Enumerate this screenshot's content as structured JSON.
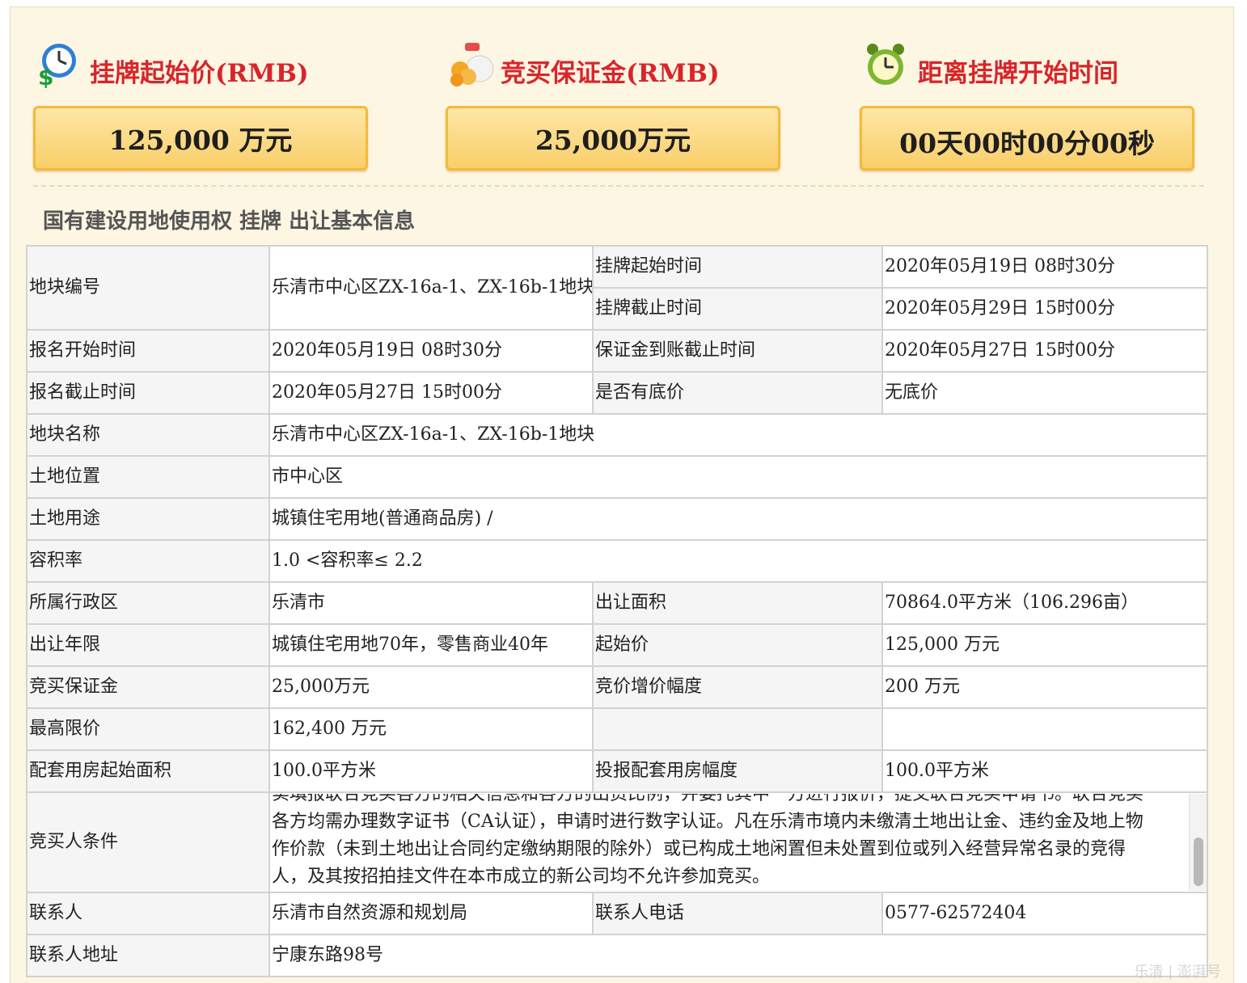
{
  "header": {
    "start_price": {
      "title": "挂牌起始价(RMB)",
      "value": "125,000 万元"
    },
    "deposit": {
      "title": "竞买保证金(RMB)",
      "value": "25,000万元"
    },
    "countdown": {
      "title": "距离挂牌开始时间",
      "value": "00天00时00分00秒"
    }
  },
  "section_title": "国有建设用地使用权 挂牌 出让基本信息",
  "table": {
    "parcel_no": {
      "label": "地块编号",
      "value": "乐清市中心区ZX-16a-1、ZX-16b-1地块"
    },
    "listing_start": {
      "label": "挂牌起始时间",
      "value": "2020年05月19日 08时30分"
    },
    "listing_end": {
      "label": "挂牌截止时间",
      "value": "2020年05月29日 15时00分"
    },
    "reg_start": {
      "label": "报名开始时间",
      "value": "2020年05月19日 08时30分"
    },
    "deposit_deadline": {
      "label": "保证金到账截止时间",
      "value": "2020年05月27日 15时00分"
    },
    "reg_end": {
      "label": "报名截止时间",
      "value": "2020年05月27日 15时00分"
    },
    "reserve_price": {
      "label": "是否有底价",
      "value": "无底价"
    },
    "parcel_name": {
      "label": "地块名称",
      "value": "乐清市中心区ZX-16a-1、ZX-16b-1地块"
    },
    "location": {
      "label": "土地位置",
      "value": "市中心区"
    },
    "usage": {
      "label": "土地用途",
      "value": "城镇住宅用地(普通商品房) /"
    },
    "far": {
      "label": "容积率",
      "value": "1.0 <容积率≤ 2.2"
    },
    "district": {
      "label": "所属行政区",
      "value": "乐清市"
    },
    "area": {
      "label": "出让面积",
      "value": "70864.0平方米（106.296亩）"
    },
    "term": {
      "label": "出让年限",
      "value": "城镇住宅用地70年，零售商业40年"
    },
    "start_price": {
      "label": "起始价",
      "value": "125,000 万元"
    },
    "deposit": {
      "label": "竞买保证金",
      "value": "25,000万元"
    },
    "increment": {
      "label": "竞价增价幅度",
      "value": "200 万元"
    },
    "max_price": {
      "label": "最高限价",
      "value": "162,400 万元"
    },
    "support_start": {
      "label": "配套用房起始面积",
      "value": "100.0平方米"
    },
    "support_step": {
      "label": "投报配套用房幅度",
      "value": "100.0平方米"
    },
    "conditions": {
      "label": "竞买人条件",
      "value": "实填报联合竞买各方的相关信息和各方的出资比例，并委托其中一方进行报价，提交联合竞买申请书。联合竞买各方均需办理数字证书（CA认证），申请时进行数字认证。凡在乐清市境内未缴清土地出让金、违约金及地上物作价款（未到土地出让合同约定缴纳期限的除外）或已构成土地闲置但未处置到位或列入经营异常名录的竞得人，及其按招拍挂文件在本市成立的新公司均不允许参加竞买。"
    },
    "contact": {
      "label": "联系人",
      "value": "乐清市自然资源和规划局"
    },
    "phone": {
      "label": "联系人电话",
      "value": "0577-62572404"
    },
    "address": {
      "label": "联系人地址",
      "value": "宁康东路98号"
    }
  },
  "watermark": "乐清 | 澎湃号",
  "icons": [
    "money-clock-icon",
    "coins-icon",
    "alarm-clock-icon"
  ],
  "colors": {
    "title_red": "#d8252b",
    "box_fill": "#f9cf6a",
    "box_border": "#f5b93a",
    "panel_bg": "#fdf6e3"
  }
}
